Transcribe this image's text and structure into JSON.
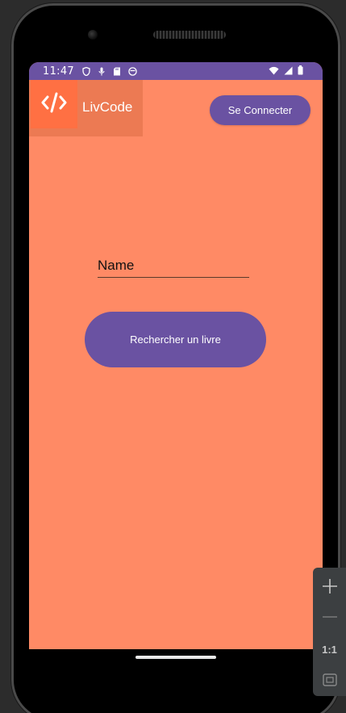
{
  "status_bar": {
    "time": "11:47",
    "left_icons": [
      "shield-icon",
      "mic-icon",
      "sd-card-icon",
      "face-icon"
    ],
    "right_icons": [
      "wifi-icon",
      "signal-icon",
      "battery-icon"
    ],
    "color": "#6a52a2"
  },
  "header": {
    "app_title": "LivCode",
    "logo_icon": "code-icon",
    "connect_label": "Se Connecter"
  },
  "form": {
    "name_value": "Name",
    "search_label": "Rechercher un livre"
  },
  "emulator_toolbar": {
    "zoom_in_icon": "plus-icon",
    "zoom_out_icon": "minus-icon",
    "ratio_label": "1:1",
    "fit_icon": "fit-screen-icon"
  },
  "colors": {
    "background": "#ff8a65",
    "primary": "#6a52a2",
    "logo_bg": "#ff7043"
  }
}
